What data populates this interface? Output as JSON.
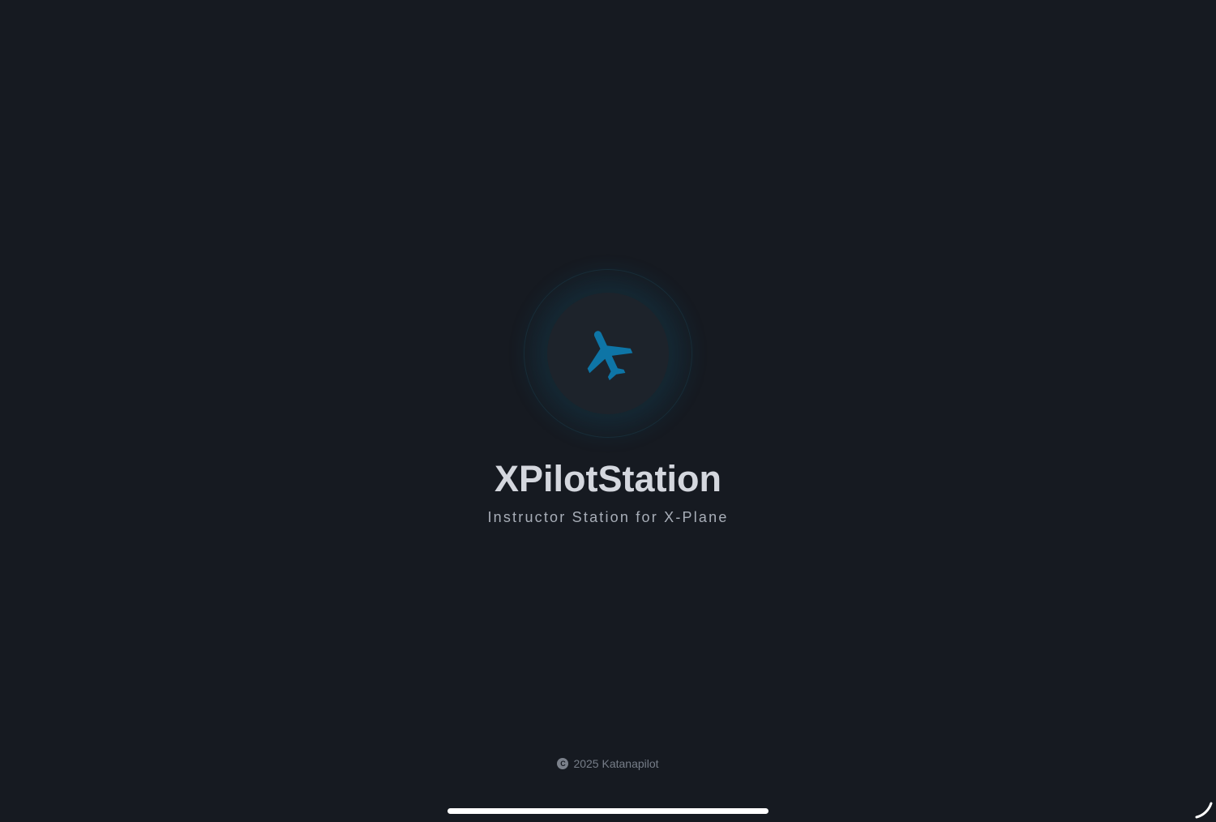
{
  "splash": {
    "icon": "airplane-icon",
    "title": "XPilotStation",
    "subtitle": "Instructor Station for X-Plane",
    "footer": {
      "copyright_icon": "copyright-icon",
      "text": "2025 Katanapilot"
    }
  },
  "colors": {
    "background": "#161a21",
    "accent": "#0e75a6",
    "title": "#d4d7de",
    "subtitle": "#a8aeb8",
    "footer": "#767d88"
  }
}
